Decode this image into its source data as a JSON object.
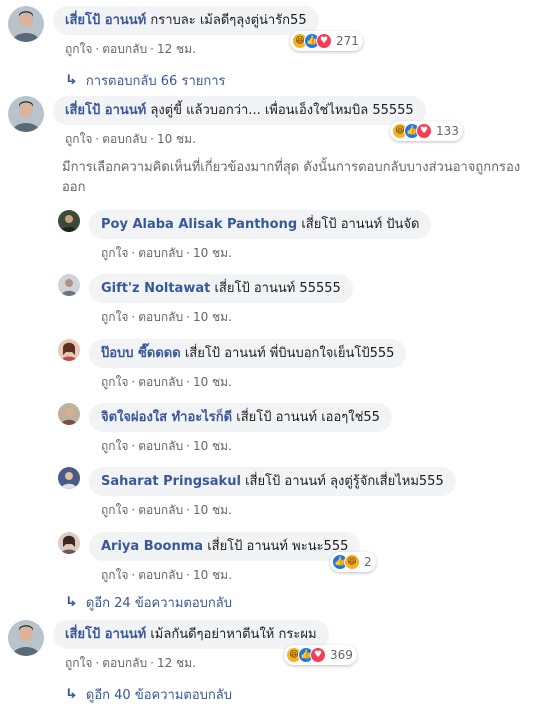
{
  "labels": {
    "like": "ถูกใจ",
    "reply": "ตอบกลับ",
    "dot": "·"
  },
  "comments": [
    {
      "author": "เสี่ยโป้ อานนท์",
      "text": "กราบละ เม้ลดีๆลุงตู่น่ารัก55",
      "time": "12 ชม.",
      "reaction_count": "271",
      "reactions": [
        "haha-icon",
        "like-icon",
        "love-icon"
      ],
      "avatar_color": "#7a8a96"
    },
    {
      "author": "เสี่ยโป้ อานนท์",
      "text": "ลุงตู่ขี้ แล้วบอกว่า... เพื่อนเอ็งใช่ไหมบิล 55555",
      "time": "10 ชม.",
      "reaction_count": "133",
      "reactions": [
        "haha-icon",
        "like-icon",
        "love-icon"
      ],
      "avatar_color": "#7a8a96"
    },
    {
      "author": "เสี่ยโป้ อานนท์",
      "text": "เม้ลกันดีๆอย่าหาตีนให้ กระผม",
      "time": "12 ชม.",
      "reaction_count": "369",
      "reactions": [
        "haha-icon",
        "like-icon",
        "love-icon"
      ],
      "avatar_color": "#7a8a96"
    }
  ],
  "replies_link_1": "การตอบกลับ 66 รายการ",
  "notice": "มีการเลือกความคิดเห็นที่เกี่ยวข้องมากที่สุด ดังนั้นการตอบกลับบางส่วนอาจถูกกรองออก",
  "replies": [
    {
      "author": "Poy Alaba Alisak Panthong",
      "mention": "เสี่ยโป้ อานนท์",
      "text": "ปันจัด",
      "time": "10 ชม.",
      "avatar_color": "#3d4a3a"
    },
    {
      "author": "Gift'z Noltawat",
      "mention": "เสี่ยโป้ อานนท์",
      "text": "55555",
      "time": "10 ชม.",
      "avatar_color": "#9aa0a8"
    },
    {
      "author": "ป๊อบบ ซี๊ดดดด",
      "mention": "เสี่ยโป้ อานนท์",
      "text": "พี่บินบอกใจเย็นโป้555",
      "time": "10 ชม.",
      "avatar_color": "#c98a7a"
    },
    {
      "author": "จิตใจผ่องใส ทำอะไรก็ดี",
      "mention": "เสี่ยโป้ อานนท์",
      "text": "เออๆใช่55",
      "time": "10 ชม.",
      "avatar_color": "#8a6d5c"
    },
    {
      "author": "Saharat Pringsakul",
      "mention": "เสี่ยโป้ อานนท์",
      "text": "ลุงตู่รู้จักเสี่ยไหม555",
      "time": "10 ชม.",
      "avatar_color": "#4a5a8a"
    },
    {
      "author": "Ariya Boonma",
      "mention": "เสี่ยโป้ อานนท์",
      "text": "พะนะ555",
      "time": "10 ชม.",
      "avatar_color": "#6e5a52",
      "reaction_count": "2",
      "reactions": [
        "like-icon",
        "haha-icon"
      ]
    }
  ],
  "more_replies_1": "ดูอีก 24 ข้อความตอบกลับ",
  "more_replies_2": "ดูอีก 40 ข้อความตอบกลับ"
}
